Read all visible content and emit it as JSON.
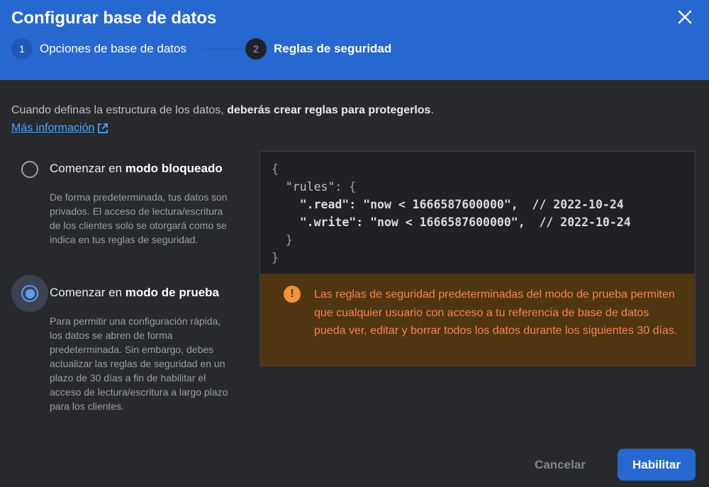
{
  "dialog": {
    "title": "Configurar base de datos",
    "steps": [
      {
        "number": "1",
        "label": "Opciones de base de datos"
      },
      {
        "number": "2",
        "label": "Reglas de seguridad"
      }
    ]
  },
  "intro": {
    "text": "Cuando definas la estructura de los datos, ",
    "bold": "deberás crear reglas para protegerlos",
    "end": ".",
    "link": "Más información"
  },
  "options": [
    {
      "label_prefix": "Comenzar en ",
      "label_bold": "modo bloqueado",
      "selected": false,
      "description": "De forma predeterminada, tus datos son privados. El acceso de lectura/escritura de los clientes solo se otorgará como se indica en tus reglas de seguridad."
    },
    {
      "label_prefix": "Comenzar en ",
      "label_bold": "modo de prueba",
      "selected": true,
      "description": "Para permitir una configuración rápida, los datos se abren de forma predeterminada. Sin embargo, debes actualizar las reglas de seguridad en un plazo de 30 días a fin de habilitar el acceso de lectura/escritura a largo plazo para los clientes."
    }
  ],
  "code": {
    "l1": "{",
    "l2_key": "  \"rules\"",
    "l2_rest": ": {",
    "l3_key": "    \".read\"",
    "l3_val": ": \"now < 1666587600000\",  // 2022-10-24",
    "l4_key": "    \".write\"",
    "l4_val": ": \"now < 1666587600000\",  // 2022-10-24",
    "l5": "  }",
    "l6": "}"
  },
  "warning": {
    "icon": "!",
    "text": "Las reglas de seguridad predeterminadas del modo de prueba permiten que cualquier usuario con acceso a tu referencia de base de datos pueda ver, editar y borrar todos los datos durante los siguientes 30 días."
  },
  "buttons": {
    "cancel": "Cancelar",
    "enable": "Habilitar"
  },
  "colors": {
    "header": "#2767d0",
    "background": "#28292c",
    "warning_bg": "#4f3512",
    "warning_text": "#f7864e",
    "accent": "#5d9cf8"
  }
}
